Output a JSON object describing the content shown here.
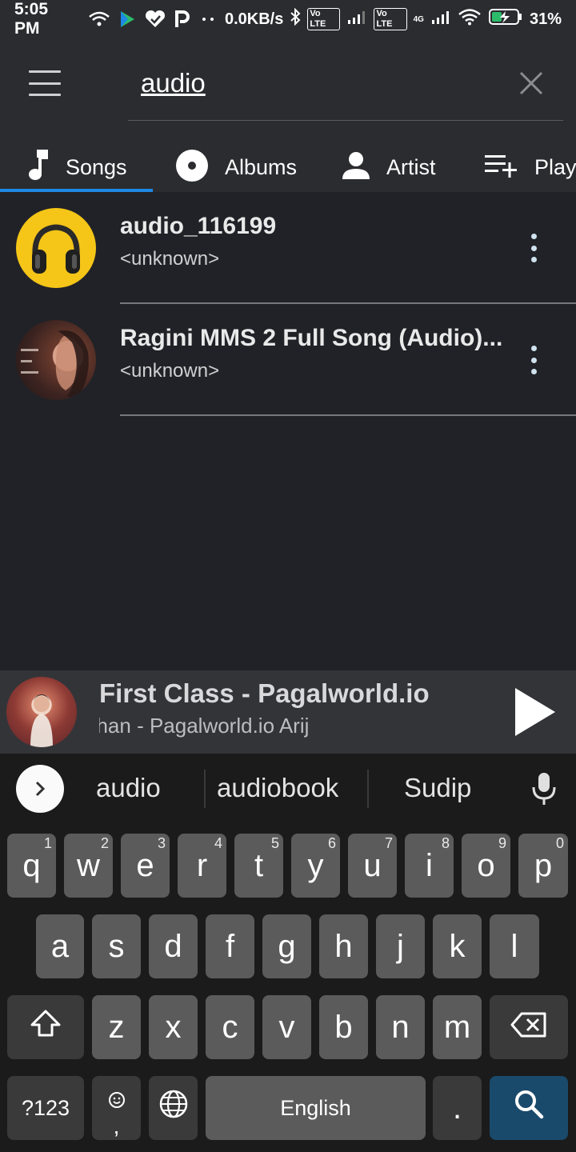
{
  "status_bar": {
    "time": "5:05 PM",
    "net_speed": "0.0KB/s",
    "volte1": "Vo LTE",
    "net_4g": "4G",
    "battery": "31%"
  },
  "search": {
    "query": "audio"
  },
  "tabs": [
    {
      "label": "Songs",
      "icon": "music-note-icon",
      "active": true
    },
    {
      "label": "Albums",
      "icon": "album-icon",
      "active": false
    },
    {
      "label": "Artist",
      "icon": "person-icon",
      "active": false
    },
    {
      "label": "Play",
      "icon": "playlist-add-icon",
      "active": false
    }
  ],
  "songs": [
    {
      "title": "audio_116199",
      "artist": "<unknown>",
      "thumb": "headphones-thumbnail"
    },
    {
      "title": "Ragini MMS 2 Full Song (Audio)...",
      "artist": "<unknown>",
      "thumb": "movie-poster-thumbnail"
    }
  ],
  "now_playing": {
    "title": "First Class - Pagalworld.io",
    "subtitle": "ohan - Pagalworld.io                   Arij"
  },
  "keyboard": {
    "suggestions": [
      "audio",
      "audiobook",
      "Sudip"
    ],
    "row1": [
      {
        "k": "q",
        "h": "1"
      },
      {
        "k": "w",
        "h": "2"
      },
      {
        "k": "e",
        "h": "3"
      },
      {
        "k": "r",
        "h": "4"
      },
      {
        "k": "t",
        "h": "5"
      },
      {
        "k": "y",
        "h": "6"
      },
      {
        "k": "u",
        "h": "7"
      },
      {
        "k": "i",
        "h": "8"
      },
      {
        "k": "o",
        "h": "9"
      },
      {
        "k": "p",
        "h": "0"
      }
    ],
    "row2": [
      "a",
      "s",
      "d",
      "f",
      "g",
      "h",
      "j",
      "k",
      "l"
    ],
    "row3": [
      "z",
      "x",
      "c",
      "v",
      "b",
      "n",
      "m"
    ],
    "symbols_label": "?123",
    "emoji_comma": ",",
    "space_label": "English",
    "period_label": "."
  },
  "colors": {
    "accent": "#1e88e5",
    "background": "#212227",
    "toolbar": "#2b2c30",
    "search_key": "#1a4a6b"
  }
}
